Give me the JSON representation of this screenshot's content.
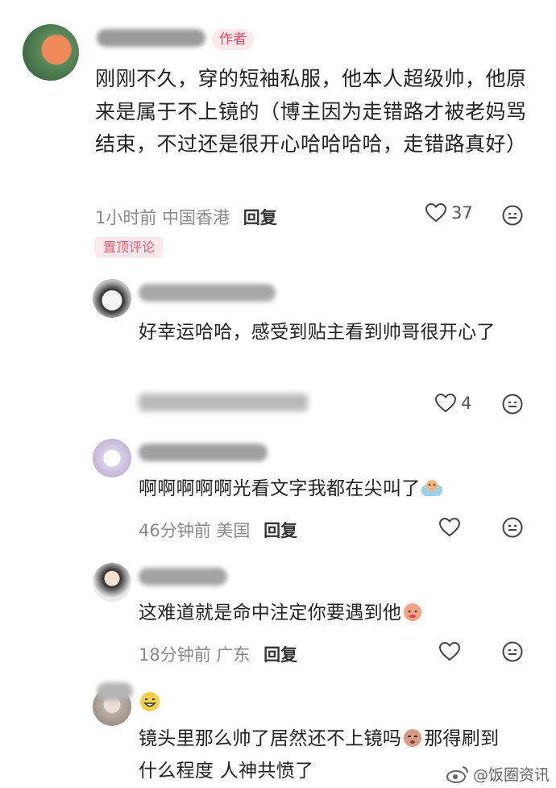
{
  "main_comment": {
    "author_badge": "作者",
    "text": "刚刚不久，穿的短袖私服，他本人超级帅，他原来是属于不上镜的（博主因为走错路才被老妈骂结束，不过还是很开心哈哈哈哈，走错路真好）",
    "time": "1小时前",
    "location": "中国香港",
    "reply_label": "回复",
    "likes": "37",
    "pin_label": "置顶评论"
  },
  "replies": [
    {
      "text": "好幸运哈哈，感受到贴主看到帅哥很开心了",
      "likes": "4"
    },
    {
      "text": "啊啊啊啊啊光看文字我都在尖叫了",
      "time": "46分钟前",
      "location": "美国",
      "reply_label": "回复"
    },
    {
      "text": "这难道就是命中注定你要遇到他",
      "time": "18分钟前",
      "location": "广东",
      "reply_label": "回复"
    },
    {
      "text": "镜头里那么帅了居然还不上镜吗",
      "text2": "那得刷到什么程度 人神共愤了"
    }
  ],
  "watermark": "@饭圈资讯",
  "icons": [
    "heart-icon",
    "smile-icon",
    "weibo-icon"
  ],
  "colors": {
    "accent_pink": "#e84a6a",
    "badge_bg": "#fde8ec"
  }
}
